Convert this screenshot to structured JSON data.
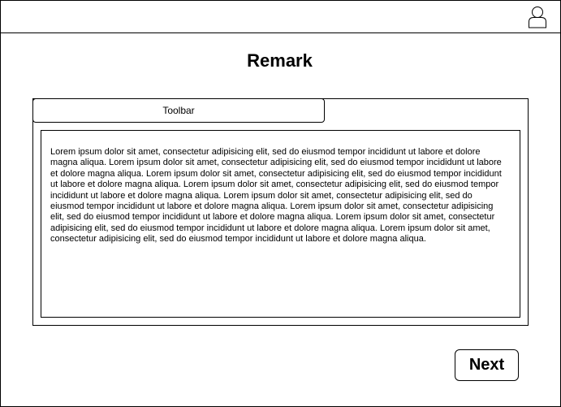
{
  "header": {
    "user_icon": "user-icon"
  },
  "page": {
    "title": "Remark"
  },
  "editor": {
    "toolbar_label": "Toolbar",
    "text": "Lorem ipsum dolor sit amet, consectetur adipisicing elit, sed do eiusmod tempor incididunt ut labore et dolore magna aliqua. Lorem ipsum dolor sit amet, consectetur adipisicing elit, sed do eiusmod tempor incididunt ut labore et dolore magna aliqua. Lorem ipsum dolor sit amet, consectetur adipisicing elit, sed do eiusmod tempor incididunt ut labore et dolore magna aliqua. Lorem ipsum dolor sit amet, consectetur adipisicing elit, sed do eiusmod tempor incididunt ut labore et dolore magna aliqua. Lorem ipsum dolor sit amet, consectetur adipisicing elit, sed do eiusmod tempor incididunt ut labore et dolore magna aliqua. Lorem ipsum dolor sit amet, consectetur adipisicing elit, sed do eiusmod tempor incididunt ut labore et dolore magna aliqua. Lorem ipsum dolor sit amet, consectetur adipisicing elit, sed do eiusmod tempor incididunt ut labore et dolore magna aliqua. Lorem ipsum dolor sit amet, consectetur adipisicing elit, sed do eiusmod tempor incididunt ut labore et dolore magna aliqua."
  },
  "footer": {
    "next_label": "Next"
  }
}
